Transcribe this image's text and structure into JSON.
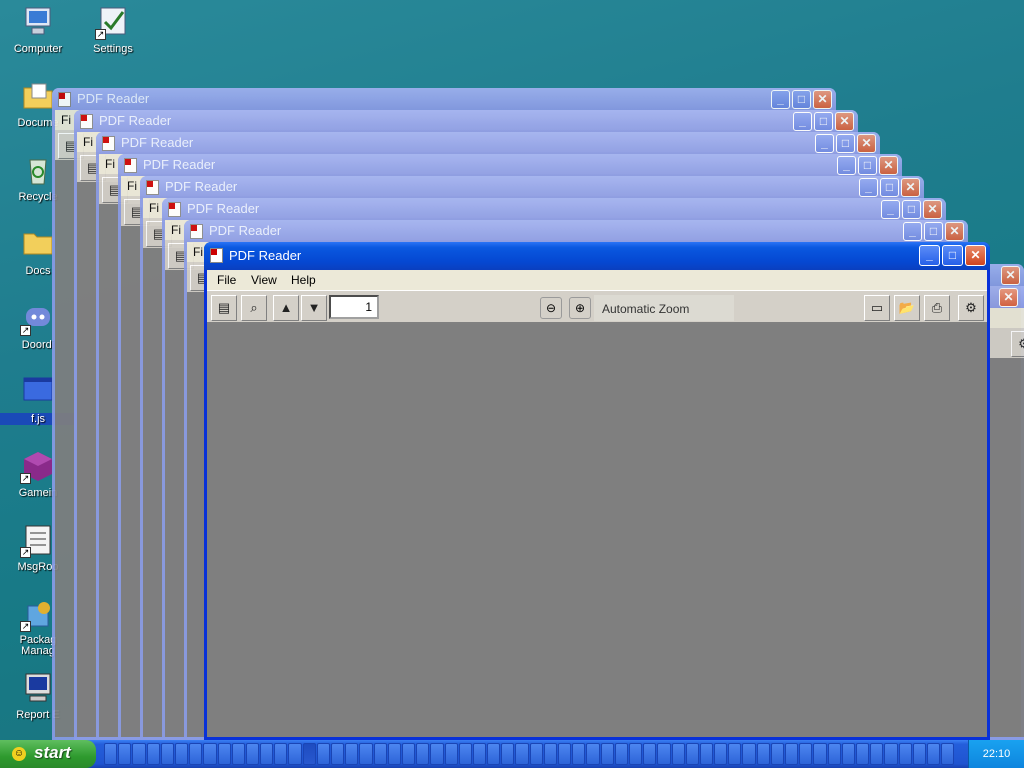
{
  "desktop": {
    "icons": [
      {
        "label": "Computer"
      },
      {
        "label": "Settings"
      },
      {
        "label": "Docume"
      },
      {
        "label": "Recycle"
      },
      {
        "label": "Docs"
      },
      {
        "label": "Doordi"
      },
      {
        "label": "f.js"
      },
      {
        "label": "Gamein"
      },
      {
        "label": "MsgRoo"
      },
      {
        "label": "Packag Manag"
      },
      {
        "label": "Report E"
      }
    ]
  },
  "windows": {
    "ghost_title": "PDF Reader",
    "ghost_menu_stub": "Fi",
    "active": {
      "title": "PDF Reader",
      "menu": [
        "File",
        "View",
        "Help"
      ],
      "page_number": "1",
      "zoom": "Automatic Zoom"
    }
  },
  "taskbar": {
    "start_label": "start",
    "clock": "22:10"
  },
  "colors": {
    "desktop": "#1f7d8e",
    "active_title": "#0548d2",
    "inactive_title": "#8a9ae4",
    "viewer_bg": "#7f7f7f",
    "taskbar": "#245edb",
    "start": "#2e9a2e"
  }
}
